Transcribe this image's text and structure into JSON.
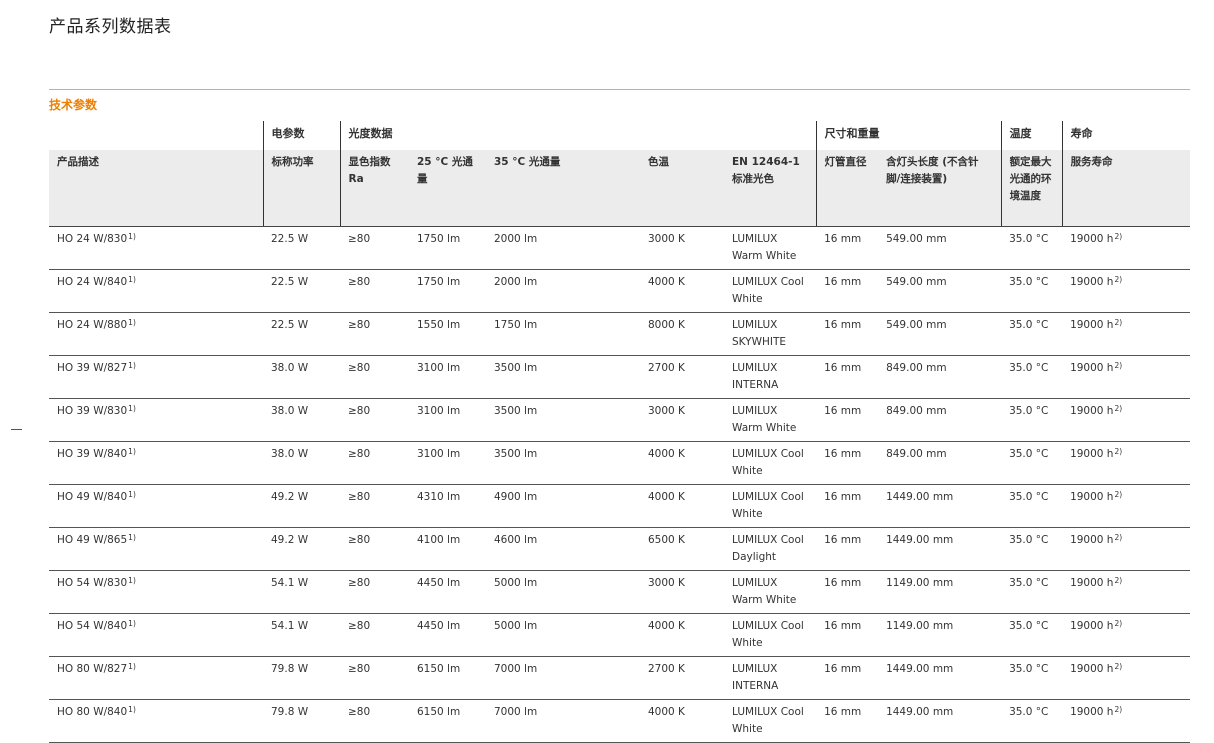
{
  "page": {
    "title": "产品系列数据表",
    "section_title": "技术参数"
  },
  "table": {
    "groups": {
      "electrical": "电参数",
      "photometric": "光度数据",
      "dimensions": "尺寸和重量",
      "temperature": "温度",
      "lifetime": "寿命"
    },
    "headers": {
      "description": "产品描述",
      "power": "标称功率",
      "cri": "显色指数 Ra",
      "flux25": "25 °C 光通量",
      "flux35": "35 °C 光通量",
      "cct": "色温",
      "en": "EN 12464-1 标准光色",
      "diameter": "灯管直径",
      "length": "含灯头长度 (不含针脚/连接装置)",
      "temp": "额定最大光通的环境温度",
      "life": "服务寿命"
    },
    "rows": [
      {
        "desc": "HO 24 W/830",
        "desc_note": "1)",
        "power": "22.5 W",
        "cri": "≥80",
        "flux25": "1750 lm",
        "flux35": "2000 lm",
        "cct": "3000 K",
        "color": "LUMILUX Warm White",
        "diameter": "16 mm",
        "length": "549.00 mm",
        "temp": "35.0 °C",
        "life": "19000 h",
        "life_note": "2)"
      },
      {
        "desc": "HO 24 W/840",
        "desc_note": "1)",
        "power": "22.5 W",
        "cri": "≥80",
        "flux25": "1750 lm",
        "flux35": "2000 lm",
        "cct": "4000 K",
        "color": "LUMILUX Cool White",
        "diameter": "16 mm",
        "length": "549.00 mm",
        "temp": "35.0 °C",
        "life": "19000 h",
        "life_note": "2)"
      },
      {
        "desc": "HO 24 W/880",
        "desc_note": "1)",
        "power": "22.5 W",
        "cri": "≥80",
        "flux25": "1550 lm",
        "flux35": "1750 lm",
        "cct": "8000 K",
        "color": "LUMILUX SKYWHITE",
        "diameter": "16 mm",
        "length": "549.00 mm",
        "temp": "35.0 °C",
        "life": "19000 h",
        "life_note": "2)"
      },
      {
        "desc": "HO 39 W/827",
        "desc_note": "1)",
        "power": "38.0 W",
        "cri": "≥80",
        "flux25": "3100 lm",
        "flux35": "3500 lm",
        "cct": "2700 K",
        "color": "LUMILUX INTERNA",
        "diameter": "16 mm",
        "length": "849.00 mm",
        "temp": "35.0 °C",
        "life": "19000 h",
        "life_note": "2)"
      },
      {
        "desc": "HO 39 W/830",
        "desc_note": "1)",
        "power": "38.0 W",
        "cri": "≥80",
        "flux25": "3100 lm",
        "flux35": "3500 lm",
        "cct": "3000 K",
        "color": "LUMILUX Warm White",
        "diameter": "16 mm",
        "length": "849.00 mm",
        "temp": "35.0 °C",
        "life": "19000 h",
        "life_note": "2)"
      },
      {
        "desc": "HO 39 W/840",
        "desc_note": "1)",
        "power": "38.0 W",
        "cri": "≥80",
        "flux25": "3100 lm",
        "flux35": "3500 lm",
        "cct": "4000 K",
        "color": "LUMILUX Cool White",
        "diameter": "16 mm",
        "length": "849.00 mm",
        "temp": "35.0 °C",
        "life": "19000 h",
        "life_note": "2)"
      },
      {
        "desc": "HO 49 W/840",
        "desc_note": "1)",
        "power": "49.2 W",
        "cri": "≥80",
        "flux25": "4310 lm",
        "flux35": "4900 lm",
        "cct": "4000 K",
        "color": "LUMILUX Cool White",
        "diameter": "16 mm",
        "length": "1449.00 mm",
        "temp": "35.0 °C",
        "life": "19000 h",
        "life_note": "2)"
      },
      {
        "desc": "HO 49 W/865",
        "desc_note": "1)",
        "power": "49.2 W",
        "cri": "≥80",
        "flux25": "4100 lm",
        "flux35": "4600 lm",
        "cct": "6500 K",
        "color": "LUMILUX Cool Daylight",
        "diameter": "16 mm",
        "length": "1449.00 mm",
        "temp": "35.0 °C",
        "life": "19000 h",
        "life_note": "2)"
      },
      {
        "desc": "HO 54 W/830",
        "desc_note": "1)",
        "power": "54.1 W",
        "cri": "≥80",
        "flux25": "4450 lm",
        "flux35": "5000 lm",
        "cct": "3000 K",
        "color": "LUMILUX Warm White",
        "diameter": "16 mm",
        "length": "1149.00 mm",
        "temp": "35.0 °C",
        "life": "19000 h",
        "life_note": "2)"
      },
      {
        "desc": "HO 54 W/840",
        "desc_note": "1)",
        "power": "54.1 W",
        "cri": "≥80",
        "flux25": "4450 lm",
        "flux35": "5000 lm",
        "cct": "4000 K",
        "color": "LUMILUX Cool White",
        "diameter": "16 mm",
        "length": "1149.00 mm",
        "temp": "35.0 °C",
        "life": "19000 h",
        "life_note": "2)"
      },
      {
        "desc": "HO 80 W/827",
        "desc_note": "1)",
        "power": "79.8 W",
        "cri": "≥80",
        "flux25": "6150 lm",
        "flux35": "7000 lm",
        "cct": "2700 K",
        "color": "LUMILUX INTERNA",
        "diameter": "16 mm",
        "length": "1449.00 mm",
        "temp": "35.0 °C",
        "life": "19000 h",
        "life_note": "2)"
      },
      {
        "desc": "HO 80 W/840",
        "desc_note": "1)",
        "power": "79.8 W",
        "cri": "≥80",
        "flux25": "6150 lm",
        "flux35": "7000 lm",
        "cct": "4000 K",
        "color": "LUMILUX Cool White",
        "diameter": "16 mm",
        "length": "1449.00 mm",
        "temp": "35.0 °C",
        "life": "19000 h",
        "life_note": "2)"
      }
    ]
  },
  "colors": {
    "accent": "#ee7f00",
    "header_bg": "#ececec"
  }
}
